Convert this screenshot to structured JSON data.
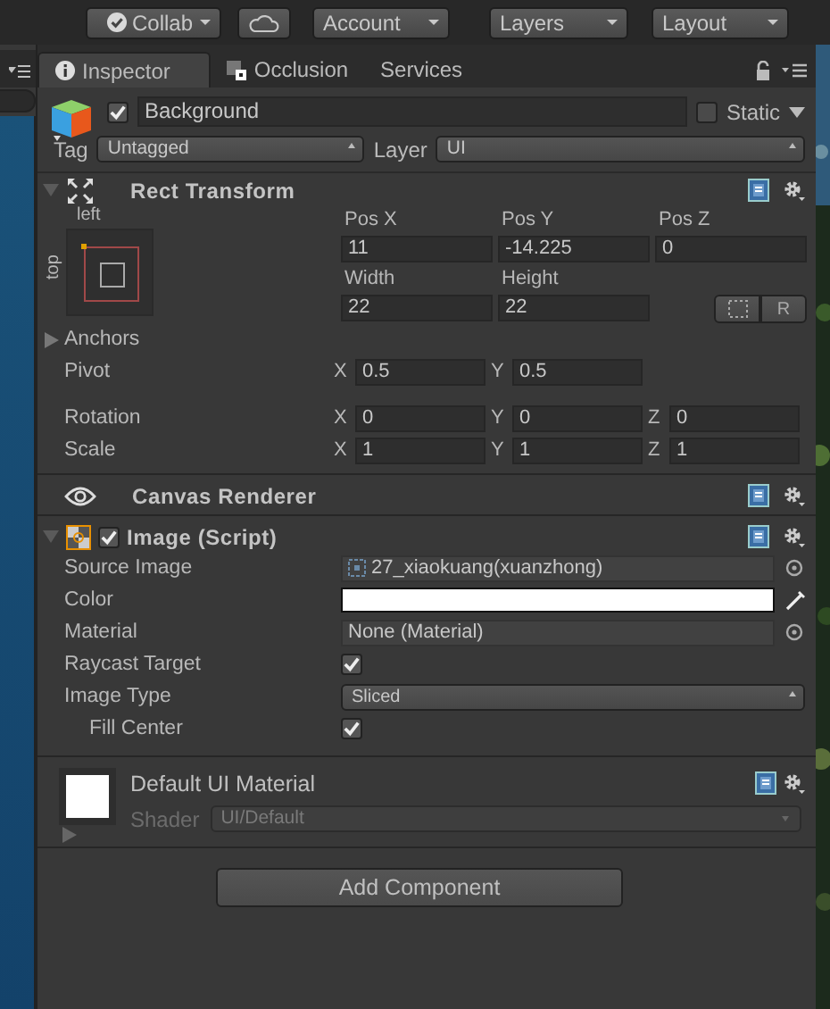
{
  "toolbar": {
    "buttons": [
      {
        "kind": "check-dropdown",
        "label": "Collab"
      },
      {
        "kind": "cloud"
      },
      {
        "kind": "dropdown",
        "label": "Account"
      },
      {
        "kind": "dropdown",
        "label": "Layers"
      },
      {
        "kind": "dropdown",
        "label": "Layout"
      }
    ]
  },
  "tabs": [
    {
      "label": "Inspector",
      "kind": "info",
      "selected": true
    },
    {
      "label": "Occlusion",
      "kind": "occlusion",
      "selected": false
    },
    {
      "label": "Services",
      "kind": "plain",
      "selected": false
    }
  ],
  "object": {
    "active": true,
    "name": "Background",
    "static": false,
    "static_label": "Static",
    "tag_label": "Tag",
    "tag": "Untagged",
    "layer_label": "Layer",
    "layer": "UI"
  },
  "rect_transform": {
    "title": "Rect Transform",
    "expanded": true,
    "anchor_h": "left",
    "anchor_v": "top",
    "pos_headers": [
      "Pos X",
      "Pos Y",
      "Pos Z"
    ],
    "pos_values": [
      "11",
      "-14.225",
      "0"
    ],
    "size_headers": [
      "Width",
      "Height"
    ],
    "size_values": [
      "22",
      "22"
    ],
    "reset_label": "R",
    "anchors": {
      "label": "Anchors",
      "expanded": false
    },
    "vector_rows": [
      {
        "label": "Pivot",
        "fields": [
          {
            "axis": "X",
            "value": "0.5"
          },
          {
            "axis": "Y",
            "value": "0.5"
          }
        ]
      },
      {
        "label": "Rotation",
        "fields": [
          {
            "axis": "X",
            "value": "0"
          },
          {
            "axis": "Y",
            "value": "0"
          },
          {
            "axis": "Z",
            "value": "0"
          }
        ]
      },
      {
        "label": "Scale",
        "fields": [
          {
            "axis": "X",
            "value": "1"
          },
          {
            "axis": "Y",
            "value": "1"
          },
          {
            "axis": "Z",
            "value": "1"
          }
        ]
      }
    ]
  },
  "canvas_renderer": {
    "title": "Canvas Renderer"
  },
  "image": {
    "title": "Image (Script)",
    "expanded": true,
    "enabled": true,
    "properties": [
      {
        "label": "Source Image",
        "kind": "object",
        "value": "27_xiaokuang(xuanzhong)",
        "sprite": true
      },
      {
        "label": "Color",
        "kind": "color",
        "color": "#ffffff"
      },
      {
        "label": "Material",
        "kind": "object",
        "value": "None (Material)",
        "sprite": false
      },
      {
        "label": "Raycast Target",
        "kind": "checkbox",
        "checked": true
      },
      {
        "label": "Image Type",
        "kind": "dropdown",
        "value": "Sliced"
      },
      {
        "label": "Fill Center",
        "kind": "checkbox",
        "checked": true,
        "indented": true
      }
    ]
  },
  "material": {
    "name": "Default UI Material",
    "expanded": false,
    "shader_label": "Shader",
    "shader": "UI/Default"
  },
  "add_component": "Add Component"
}
